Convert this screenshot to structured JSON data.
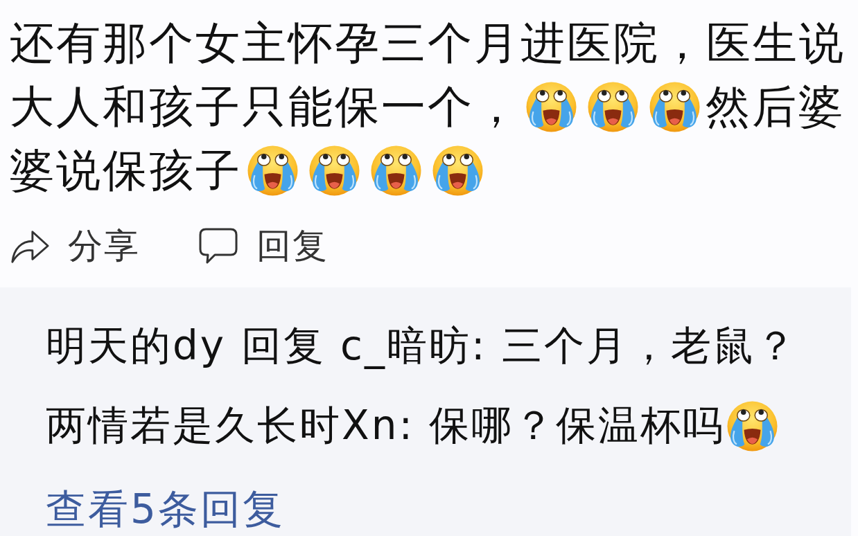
{
  "comment": {
    "lines": [
      {
        "segments": [
          {
            "kind": "text",
            "text": "还有那个女主怀孕三个月进医院，医生说"
          }
        ]
      },
      {
        "segments": [
          {
            "kind": "text",
            "text": "大人和孩子只能保一个，"
          },
          {
            "kind": "emoji"
          },
          {
            "kind": "emoji"
          },
          {
            "kind": "emoji"
          },
          {
            "kind": "text",
            "text": "然后婆"
          }
        ]
      },
      {
        "segments": [
          {
            "kind": "text",
            "text": "婆说保孩子"
          },
          {
            "kind": "emoji"
          },
          {
            "kind": "emoji"
          },
          {
            "kind": "emoji"
          },
          {
            "kind": "emoji"
          }
        ]
      }
    ]
  },
  "actions": [
    {
      "kind": "share",
      "label": "分享"
    },
    {
      "kind": "reply",
      "label": "回复"
    }
  ],
  "replies": {
    "items": [
      {
        "segments": [
          {
            "kind": "text",
            "text": "明天的dy 回复 c_暗昉: 三个月，老鼠？"
          }
        ]
      },
      {
        "segments": [
          {
            "kind": "text",
            "text": "两情若是久长时Xn: 保哪？保温杯吗"
          },
          {
            "kind": "emoji"
          }
        ]
      }
    ],
    "more_link": "查看5条回复"
  }
}
